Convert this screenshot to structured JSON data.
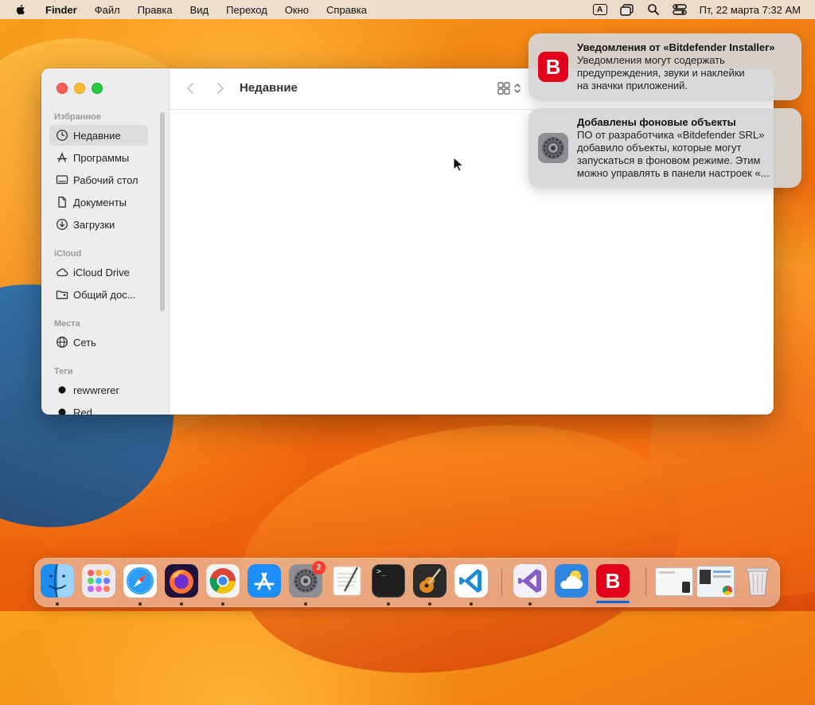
{
  "menubar": {
    "app": "Finder",
    "items": [
      "Файл",
      "Правка",
      "Вид",
      "Переход",
      "Окно",
      "Справка"
    ],
    "input_indicator": "A",
    "datetime": "Пт, 22 марта  7:32 AM"
  },
  "finder": {
    "title": "Недавние",
    "sections": {
      "favorites": "Избранное",
      "icloud": "iCloud",
      "places": "Места",
      "tags": "Теги"
    },
    "favorites": [
      "Недавние",
      "Программы",
      "Рабочий стол",
      "Документы",
      "Загрузки"
    ],
    "icloud": [
      "iCloud Drive",
      "Общий дос..."
    ],
    "places": [
      "Сеть"
    ],
    "tags": [
      "rewwrerer",
      "Red"
    ]
  },
  "notifications": [
    {
      "title": "Уведомления от «Bitdefender Installer»",
      "body": [
        "Уведомления могут содержать",
        "предупреждения, звуки и наклейки",
        "на значки приложений."
      ],
      "icon": "bitdefender-icon",
      "icon_letter": "B"
    },
    {
      "title": "Добавлены фоновые объекты",
      "body": [
        "ПО от разработчика «Bitdefender SRL»",
        "добавило объекты, которые могут",
        "запускаться в фоновом режиме. Этим",
        "можно управлять в панели настроек «..."
      ],
      "icon": "system-settings-icon"
    }
  ],
  "dock": {
    "apps": [
      "finder",
      "launchpad",
      "safari",
      "firefox",
      "chrome",
      "app-store",
      "system-settings",
      "textedit",
      "terminal",
      "garageband",
      "vscode",
      "visual-studio",
      "weather",
      "bitdefender"
    ],
    "settings_badge": "2",
    "bitdefender_letter": "B",
    "terminal_prompt": ">_"
  },
  "colors": {
    "accent": "#0a64d8",
    "bitdefender": "#e2001a",
    "badge": "#ff3b30"
  }
}
